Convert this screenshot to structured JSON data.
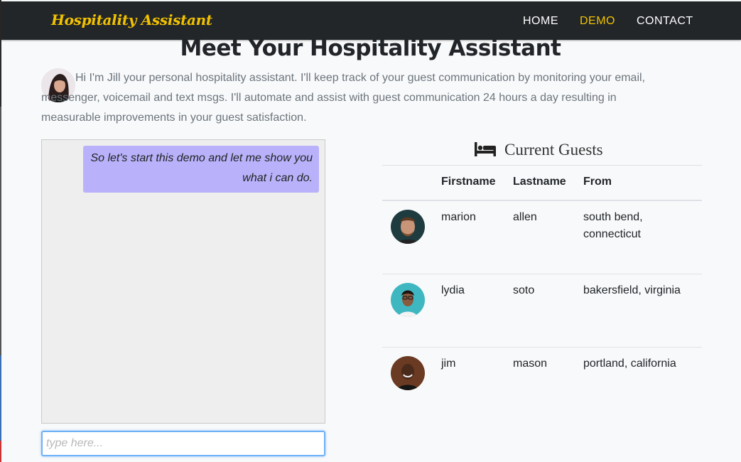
{
  "navbar": {
    "brand": "Hospitality Assistant",
    "links": [
      {
        "label": "HOME",
        "active": false
      },
      {
        "label": "DEMO",
        "active": true
      },
      {
        "label": "CONTACT",
        "active": false
      }
    ],
    "accent_color": "#f2c200",
    "background_color": "#222629"
  },
  "page": {
    "title": "Meet Your Hospitality Assistant",
    "intro": "Hi I'm Jill your personal hospitality assistant. I'll keep track of your guest communication by monitoring your email, messenger, voicemail and text msgs. I'll automate and assist with guest communication 24 hours a day resulting in measurable improvements in your guest satisfaction."
  },
  "chat": {
    "messages": [
      {
        "text": "So let's start this demo and let me show you what i can do.",
        "bubble_color": "#b9b2fb"
      }
    ],
    "input": {
      "placeholder": "type here...",
      "value": ""
    }
  },
  "guests": {
    "title": "Current Guests",
    "icon": "bed-icon",
    "columns": [
      "Firstname",
      "Lastname",
      "From"
    ],
    "rows": [
      {
        "firstname": "marion",
        "lastname": "allen",
        "from": "south bend, connecticut"
      },
      {
        "firstname": "lydia",
        "lastname": "soto",
        "from": "bakersfield, virginia"
      },
      {
        "firstname": "jim",
        "lastname": "mason",
        "from": "portland, california"
      }
    ]
  }
}
